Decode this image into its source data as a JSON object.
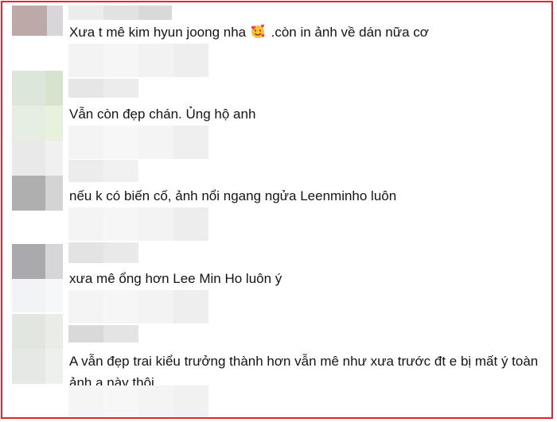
{
  "comments": [
    {
      "text_before": "Xưa t mê kim hyun joong nha",
      "emoji": "smiling-face-with-hearts-icon",
      "text_after": " .còn in ảnh về dán nữa cơ"
    },
    {
      "text": "Vẫn còn đẹp chán. Ủng hộ anh"
    },
    {
      "text": "nếu k có biến cố, ảnh nổi ngang ngửa Leenminho luôn"
    },
    {
      "text": "xưa mê ổng hơn Lee Min Ho luôn ý"
    },
    {
      "text": "A vẫn đẹp trai kiểu trưởng thành hơn vẫn mê như xưa trước đt e bị mất ý toàn ảnh a này thôi"
    }
  ],
  "colors": {
    "frame_border": "#e8232b",
    "text": "#141414"
  }
}
